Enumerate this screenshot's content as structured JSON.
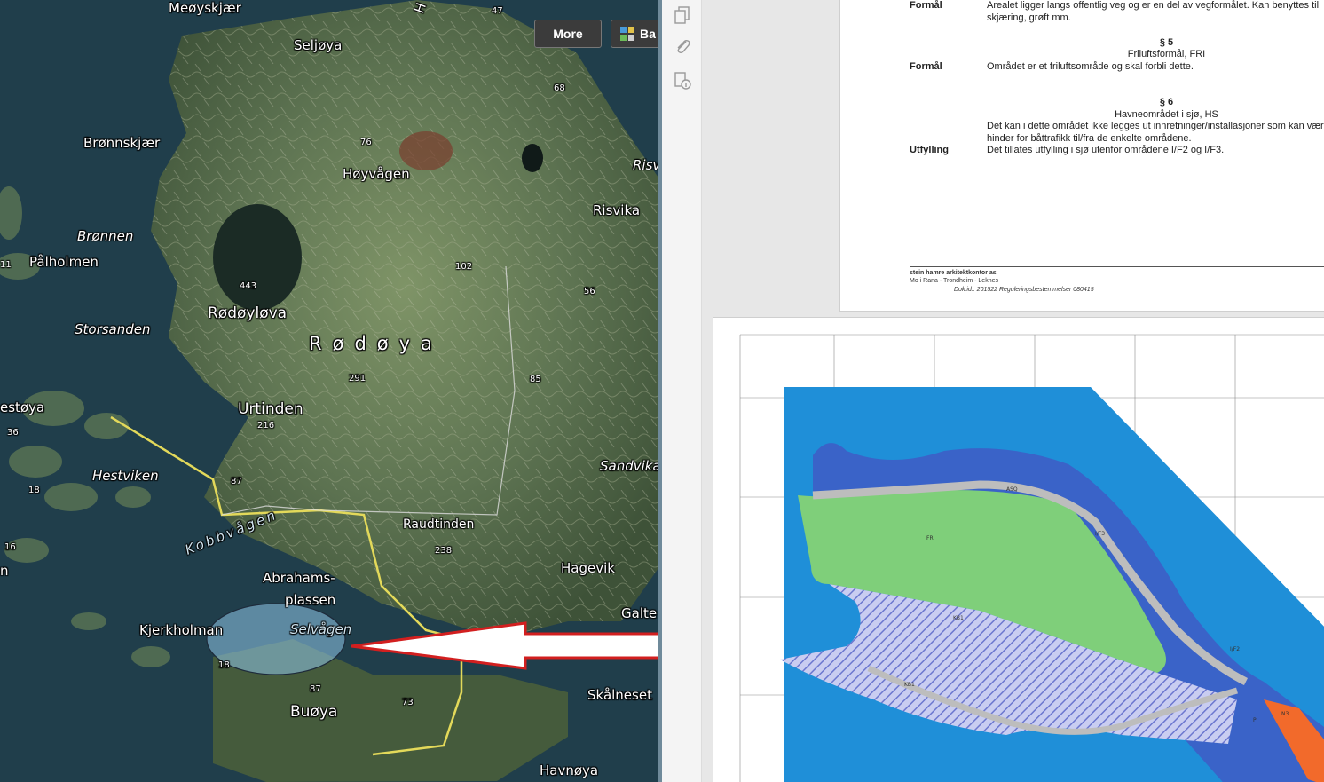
{
  "map": {
    "more_label": "More",
    "basemap_label": "Ba",
    "island_name": "Rødøya",
    "labels": {
      "meoyskjaer": "Meøyskjær",
      "seljoya": "Seljøya",
      "bronnskjaer": "Brønnskjær",
      "hoyvagen": "Høyvågen",
      "risv": "Risv",
      "risvika": "Risvika",
      "bronnen": "Brønnen",
      "palholmen": "Pålholmen",
      "rodoyleva": "Rødøyløva",
      "storsanden": "Storsanden",
      "estoya": "estøya",
      "urtinden": "Urtinden",
      "hestviken": "Hestviken",
      "sandvika": "Sandvika",
      "raudtinden": "Raudtinden",
      "kobbvagen": "Kobbvågen",
      "hagevik": "Hagevik",
      "abrahams1": "Abrahams-",
      "abrahams2": "plassen",
      "galte": "Galte",
      "kjerkholman": "Kjerkholman",
      "selvagen": "Selvågen",
      "skalneset": "Skålneset",
      "buoya": "Buøya",
      "havnoya": "Havnøya",
      "n": "n",
      "h": "H"
    },
    "elevations": {
      "e47": "47",
      "e68": "68",
      "e76": "76",
      "e443": "443",
      "e102": "102",
      "e56": "56",
      "e291": "291",
      "e85": "85",
      "e216": "216",
      "e87a": "87",
      "e36": "36",
      "e18": "18",
      "e16": "16",
      "e11": "11",
      "e238": "238",
      "e87b": "87",
      "e73": "73",
      "e18b": "18"
    }
  },
  "document": {
    "rows": [
      {
        "term": "Formål",
        "text": "Arealet ligger langs offentlig veg og er en del av vegformålet. Kan benyttes til skjæring, grøft mm."
      },
      {
        "term": "Formål",
        "text": "Området er et friluftsområde og skal forbli dette."
      },
      {
        "term": "Utfylling",
        "text": "Det tillates utfylling i sjø utenfor områdene I/F2 og I/F3."
      }
    ],
    "section5": {
      "num": "§ 5",
      "title": "Friluftsformål, FRI"
    },
    "section6": {
      "num": "§ 6",
      "title": "Havneområdet i sjø, HS",
      "body": "Det kan i dette området ikke legges ut innretninger/installasjoner som kan være til hinder for båttrafikk til/fra de enkelte områdene."
    },
    "footer": {
      "company": "stein hamre arkitektkontor as",
      "cities": "Mo i Rana   -   Trondheim   -   Leknes",
      "docid": "Dok.id.:  201522 Reguleringsbestemmelser 080415"
    }
  },
  "plan": {
    "labels": {
      "fri": "FRI",
      "ifi3": "I/F3",
      "ifi2": "I/F2",
      "kb1": "KB1",
      "asq": "ASQ",
      "n3": "N3",
      "p": "P",
      "kb1b": "KB1"
    }
  },
  "colors": {
    "sea_blue": "#1f8fd8",
    "harbour_blue": "#3a63c8",
    "green": "#7fcf7a",
    "hatch": "#7e88d6",
    "arrow_red": "#d21f1f",
    "orange": "#f26a2b"
  }
}
